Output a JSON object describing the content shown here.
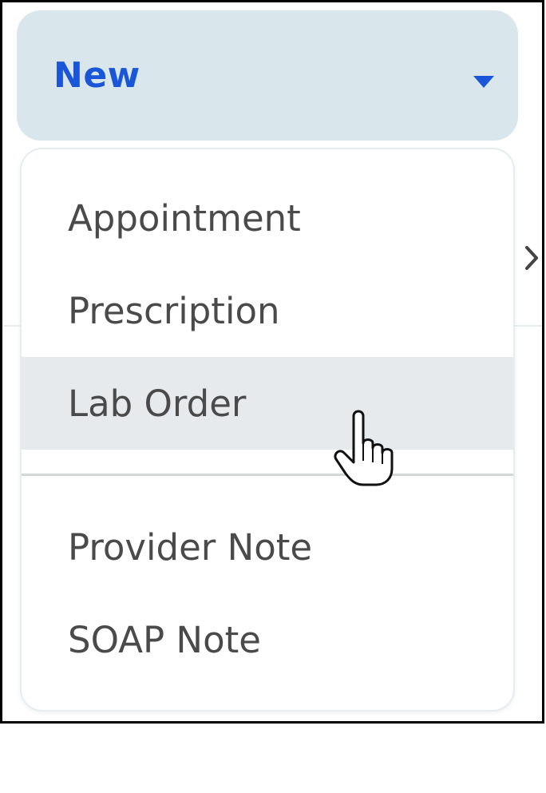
{
  "new_button": {
    "label": "New",
    "caret_icon": "caret-down-icon",
    "background": "#d9e6ec",
    "label_color": "#1a56d8"
  },
  "menu": {
    "items": [
      {
        "label": "Appointment"
      },
      {
        "label": "Prescription"
      },
      {
        "label": "Lab Order",
        "hovered": true
      },
      {
        "label": "Provider Note"
      },
      {
        "label": "SOAP Note"
      }
    ],
    "hover_background": "#e6eaed"
  },
  "background": {
    "chevron_icon": "chevron-right-icon"
  },
  "cursor_icon": "hand-pointer-icon"
}
